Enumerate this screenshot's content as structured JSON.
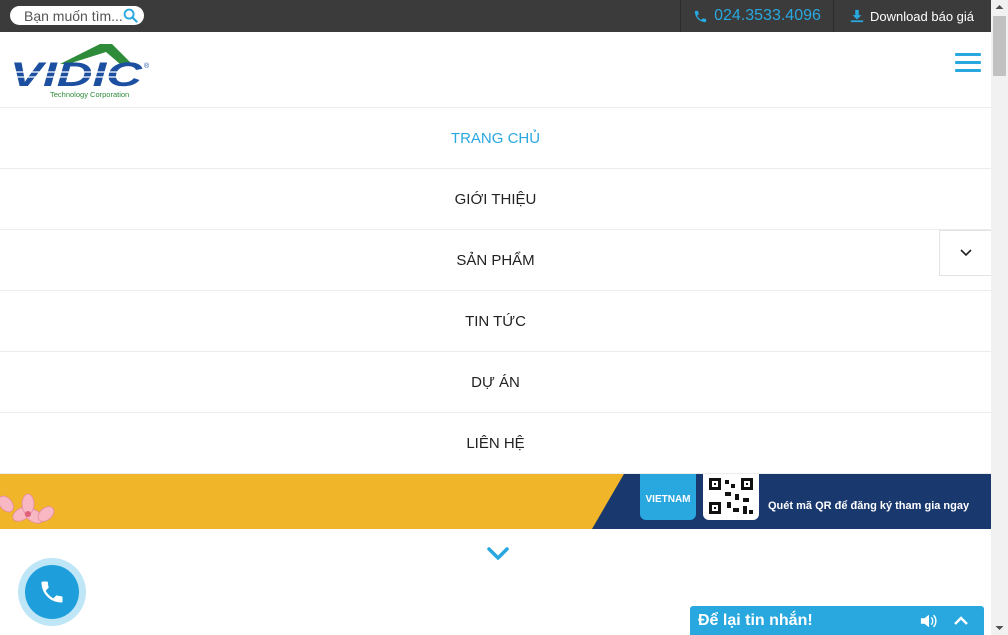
{
  "topbar": {
    "search_placeholder": "Bạn muốn tìm...",
    "phone": "024.3533.4096",
    "download_label": "Download báo giá",
    "search_icon": "search-icon",
    "phone_icon": "phone-icon",
    "download_icon": "download-icon"
  },
  "header": {
    "logo_text": "VIDIC",
    "logo_subtitle": "Technology Corporation",
    "menu_icon": "hamburger-icon"
  },
  "menu": {
    "items": [
      {
        "label": "TRANG CHỦ",
        "active": true
      },
      {
        "label": "GIỚI THIỆU",
        "active": false
      },
      {
        "label": "SẢN PHẨM",
        "active": false
      },
      {
        "label": "TIN TỨC",
        "active": false
      },
      {
        "label": "DỰ ÁN",
        "active": false
      },
      {
        "label": "LIÊN HỆ",
        "active": false
      }
    ],
    "submenu_icon": "chevron-down-icon"
  },
  "banner": {
    "card_text": "VIETNAM",
    "qr_text": "Quét mã QR để đăng ký tham gia ngay"
  },
  "chat": {
    "label": "Để lại tin nhắn!",
    "sound_icon": "speaker-icon",
    "expand_icon": "chevron-up-icon"
  },
  "colors": {
    "accent": "#29a8e0",
    "topbar_bg": "#3b3b3b",
    "logo_blue": "#1c4fa0",
    "logo_green": "#2e8b3a",
    "banner_gold": "#f0b528",
    "banner_navy": "#19386e"
  }
}
